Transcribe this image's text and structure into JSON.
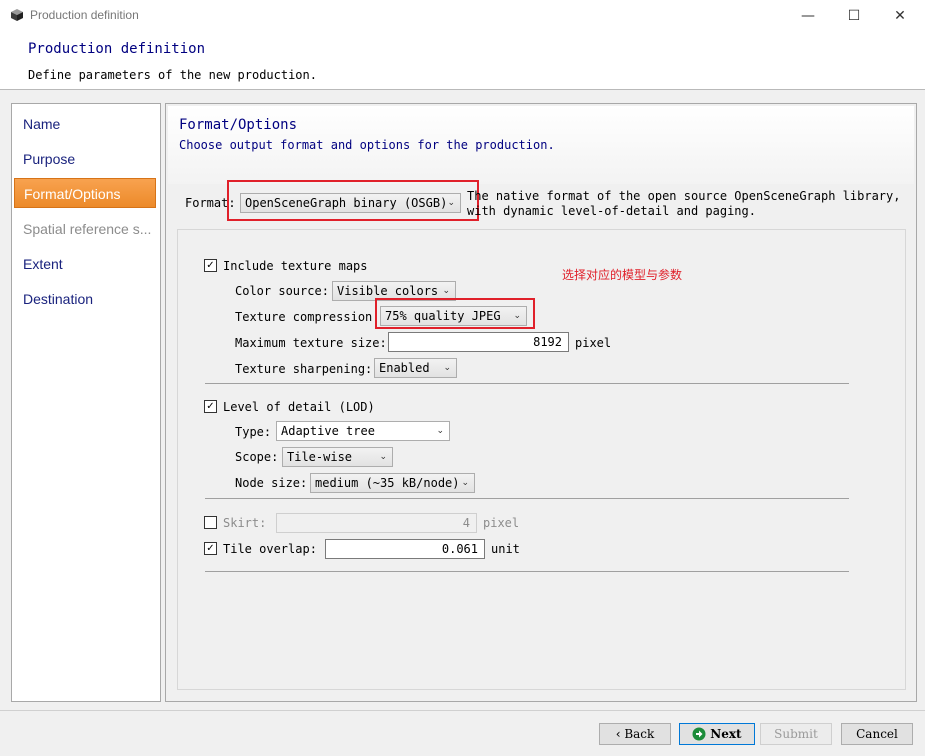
{
  "window": {
    "title": "Production definition"
  },
  "header": {
    "title": "Production definition",
    "subtitle": "Define parameters of the new production."
  },
  "sidebar": {
    "items": [
      {
        "label": "Name",
        "state": "normal"
      },
      {
        "label": "Purpose",
        "state": "normal"
      },
      {
        "label": "Format/Options",
        "state": "active"
      },
      {
        "label": "Spatial reference s...",
        "state": "disabled"
      },
      {
        "label": "Extent",
        "state": "normal"
      },
      {
        "label": "Destination",
        "state": "normal"
      }
    ]
  },
  "panel": {
    "title": "Format/Options",
    "subtitle": "Choose output format and options for the production.",
    "format_label": "Format:",
    "format_value": "OpenSceneGraph binary (OSGB)",
    "format_desc_1": "The native format of the open source OpenSceneGraph library,",
    "format_desc_2": "with dynamic level-of-detail and paging."
  },
  "annotation": {
    "text": "选择对应的模型与参数",
    "color": "#e0202a"
  },
  "texture": {
    "include_label": "Include texture maps",
    "include_checked": true,
    "color_source_label": "Color source:",
    "color_source_value": "Visible colors",
    "compression_label": "Texture compression:",
    "compression_value": "75% quality JPEG",
    "max_size_label": "Maximum texture size:",
    "max_size_value": "8192",
    "max_size_unit": "pixel",
    "sharpening_label": "Texture sharpening:",
    "sharpening_value": "Enabled"
  },
  "lod": {
    "label": "Level of detail (LOD)",
    "checked": true,
    "type_label": "Type:",
    "type_value": "Adaptive tree",
    "scope_label": "Scope:",
    "scope_value": "Tile-wise",
    "node_size_label": "Node size:",
    "node_size_value": "medium (~35 kB/node)"
  },
  "skirt": {
    "label": "Skirt:",
    "checked": false,
    "value": "4",
    "unit": "pixel"
  },
  "overlap": {
    "label": "Tile overlap:",
    "checked": true,
    "value": "0.061",
    "unit": "unit"
  },
  "footer": {
    "back": "Back",
    "next": "Next",
    "submit": "Submit",
    "cancel": "Cancel"
  },
  "icons": {
    "back": "chevron-left-icon",
    "next": "arrow-right-circle-icon"
  }
}
